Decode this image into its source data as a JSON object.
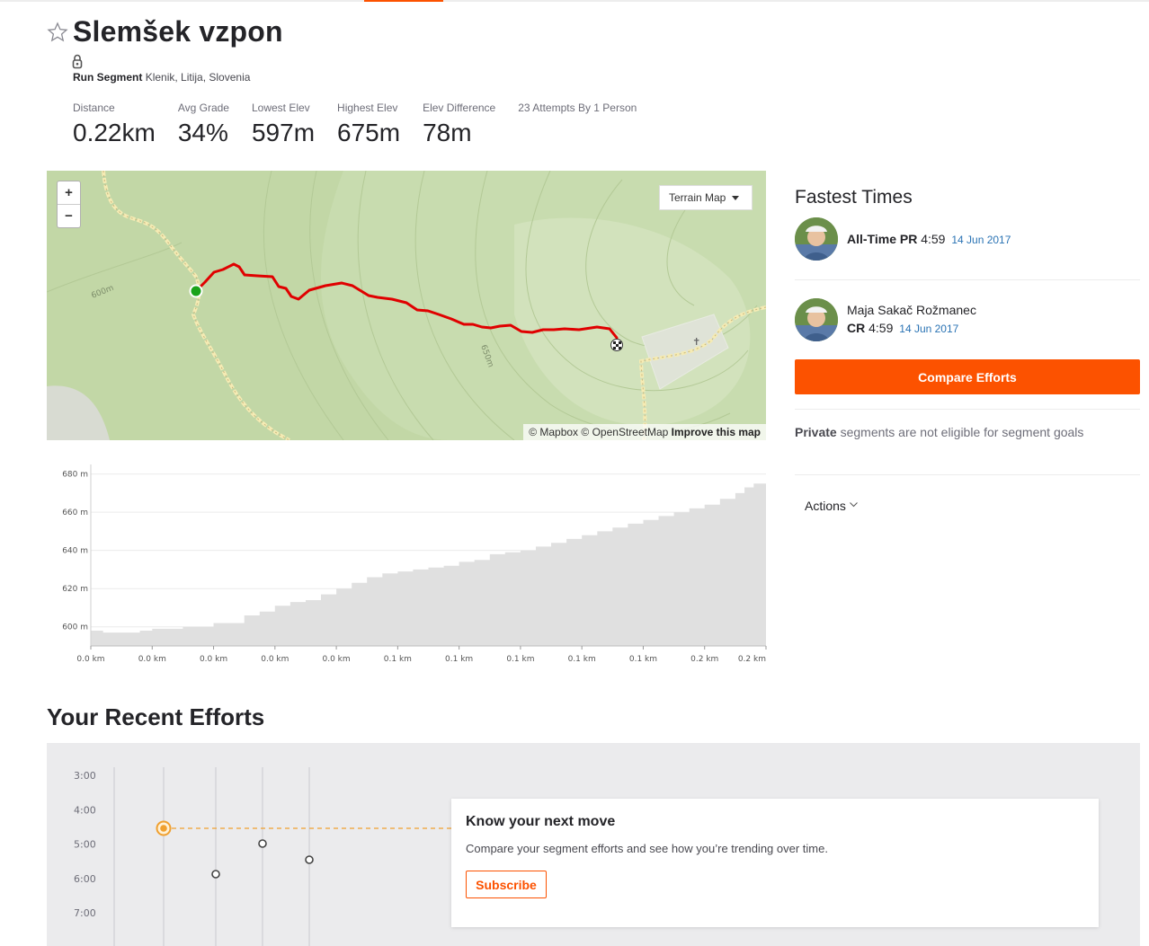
{
  "segment": {
    "title": "Slemšek vzpon",
    "type_label": "Run Segment",
    "location": "Klenik, Litija, Slovenia",
    "stats": [
      {
        "label": "Distance",
        "value": "0.22km"
      },
      {
        "label": "Avg Grade",
        "value": "34%"
      },
      {
        "label": "Lowest Elev",
        "value": "597m"
      },
      {
        "label": "Highest Elev",
        "value": "675m"
      },
      {
        "label": "Elev Difference",
        "value": "78m"
      },
      {
        "label": "23 Attempts By 1 Person",
        "value": ""
      }
    ]
  },
  "map": {
    "zoom_in": "+",
    "zoom_out": "−",
    "map_type": "Terrain Map",
    "contour_label_1": "600m",
    "contour_label_2": "650m",
    "attribution_1": "© Mapbox",
    "attribution_2": "© OpenStreetMap",
    "improve": "Improve this map",
    "route_color": "#e00000",
    "start_color": "#1aa31a"
  },
  "elevation_profile": {
    "y_ticks": [
      "680 m",
      "660 m",
      "640 m",
      "620 m",
      "600 m"
    ],
    "x_ticks": [
      "0.0 km",
      "0.0 km",
      "0.0 km",
      "0.0 km",
      "0.0 km",
      "0.1 km",
      "0.1 km",
      "0.1 km",
      "0.1 km",
      "0.1 km",
      "0.2 km",
      "0.2 km"
    ]
  },
  "sidebar": {
    "fastest_title": "Fastest Times",
    "pr_label": "All-Time PR",
    "pr_time": "4:59",
    "pr_date": "14 Jun 2017",
    "cr_name": "Maja Sakač Rožmanec",
    "cr_label": "CR",
    "cr_time": "4:59",
    "cr_date": "14 Jun 2017",
    "compare_button": "Compare Efforts",
    "private_bold": "Private",
    "private_text": " segments are not eligible for segment goals",
    "actions_label": "Actions"
  },
  "recent": {
    "title": "Your Recent Efforts",
    "y_ticks": [
      "3:00",
      "4:00",
      "5:00",
      "6:00",
      "7:00"
    ],
    "upsell_title": "Know your next move",
    "upsell_text": "Compare your segment efforts and see how you’re trending over time.",
    "subscribe_button": "Subscribe"
  },
  "colors": {
    "brand": "#fc5200",
    "pr_marker": "#f0a030",
    "date_link": "#2a73b4"
  },
  "chart_data": {
    "type": "area",
    "title": "",
    "xlabel": "",
    "ylabel": "",
    "ylim": [
      590,
      685
    ],
    "xlim": [
      0,
      0.22
    ],
    "x_unit": "km",
    "y_unit": "m",
    "x": [
      0.0,
      0.004,
      0.01,
      0.016,
      0.02,
      0.03,
      0.04,
      0.05,
      0.055,
      0.06,
      0.065,
      0.07,
      0.075,
      0.08,
      0.085,
      0.09,
      0.095,
      0.1,
      0.105,
      0.11,
      0.115,
      0.12,
      0.125,
      0.13,
      0.135,
      0.14,
      0.145,
      0.15,
      0.155,
      0.16,
      0.165,
      0.17,
      0.175,
      0.18,
      0.185,
      0.19,
      0.195,
      0.2,
      0.205,
      0.21,
      0.213,
      0.216,
      0.22
    ],
    "series": [
      {
        "values": [
          598,
          597,
          597,
          598,
          599,
          600,
          602,
          606,
          608,
          611,
          613,
          614,
          617,
          620,
          623,
          626,
          628,
          629,
          630,
          631,
          632,
          634,
          635,
          638,
          639,
          640,
          642,
          644,
          646,
          648,
          650,
          652,
          654,
          656,
          658,
          660,
          662,
          664,
          667,
          670,
          673,
          675,
          674
        ]
      }
    ]
  }
}
